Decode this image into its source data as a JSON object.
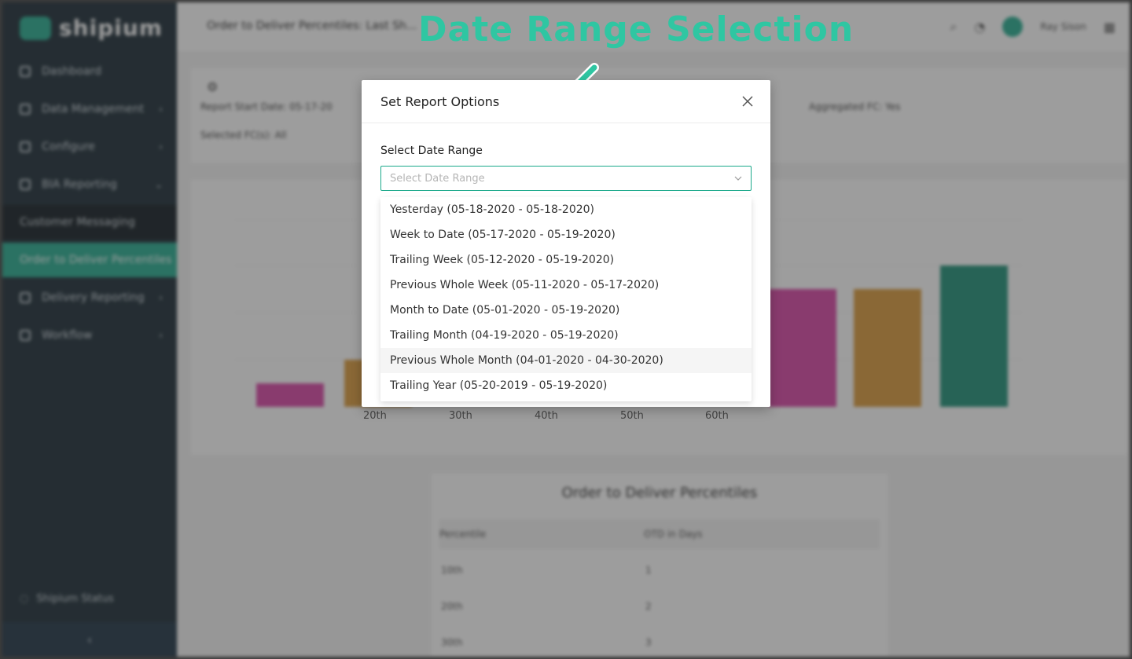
{
  "annotation": {
    "label": "Date Range Selection",
    "color": "#2fc6a2"
  },
  "background": {
    "logo_text": "shipium",
    "topbar_title": "Order to Deliver Percentiles: Last Sh...",
    "user_name": "Ray Sison",
    "nav_items": [
      {
        "label": "Dashboard"
      },
      {
        "label": "Data Management"
      },
      {
        "label": "Configure"
      },
      {
        "label": "BIA Reporting"
      },
      {
        "label": "Customer Messaging"
      },
      {
        "label": "Order to Deliver Percentiles"
      },
      {
        "label": "Delivery Reporting"
      },
      {
        "label": "Workflow"
      }
    ],
    "sidebar_footer": "Shipium Status",
    "info_report_start": "Report Start Date: 05-17-20",
    "info_selected_fcs": "Selected FC(s): All",
    "info_aggregated": "Aggregated FC: Yes",
    "table_title": "Order to Deliver Percentiles",
    "table_headers": [
      "Percentile",
      "OTD in Days"
    ],
    "table_rows": [
      [
        "10th",
        "1"
      ],
      [
        "20th",
        "2"
      ],
      [
        "30th",
        "3"
      ]
    ],
    "chart_x_ticks_visible": [
      "20th",
      "30th",
      "40th",
      "50th",
      "60th"
    ]
  },
  "modal": {
    "title": "Set Report Options",
    "field_label": "Select Date Range",
    "placeholder": "Select Date Range",
    "options": [
      "Yesterday (05-18-2020 - 05-18-2020)",
      "Week to Date (05-17-2020 - 05-19-2020)",
      "Trailing Week (05-12-2020 - 05-19-2020)",
      "Previous Whole Week (05-11-2020 - 05-17-2020)",
      "Month to Date (05-01-2020 - 05-19-2020)",
      "Trailing Month (04-19-2020 - 05-19-2020)",
      "Previous Whole Month (04-01-2020 - 04-30-2020)",
      "Trailing Year (05-20-2019 - 05-19-2020)"
    ],
    "hovered_index": 6,
    "accent_color": "#1aa88a"
  }
}
